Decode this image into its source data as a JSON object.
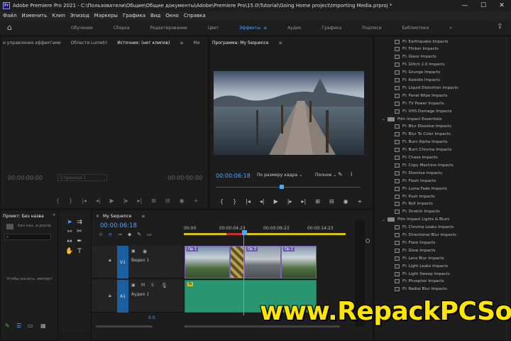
{
  "titlebar": {
    "title": "Adobe Premiere Pro 2021 - C:\\Пользователи\\Общие\\Общие документы\\Adobe\\Premiere Pro\\15.0\\Tutorial\\Going Home project\\Importing Media.prproj *",
    "minimize": "—",
    "maximize": "☐",
    "close": "✕"
  },
  "menu": [
    "Файл",
    "Изменить",
    "Клип",
    "Эпизод",
    "Маркеры",
    "Графика",
    "Вид",
    "Окно",
    "Справка"
  ],
  "workspaces": {
    "tabs": [
      "Обучение",
      "Сборка",
      "Редактирование",
      "Цвет",
      "Эффекты",
      "Аудио",
      "Графика",
      "Подписи",
      "Библиотеки"
    ],
    "active": "Эффекты",
    "more": "»"
  },
  "source_panel": {
    "tabs": [
      "и управления эффектами",
      "Области Lumetri",
      "Источник: (нет клипов)",
      "Ми"
    ],
    "active_tab": "Источник: (нет клипов)",
    "timecode_left": "00:00:00:00",
    "fit": "Страница 1",
    "timecode_right": "00:00:00:00"
  },
  "program_panel": {
    "title": "Программа: My Sequence",
    "timecode": "00:00:06:18",
    "fit": "По размеру кадра",
    "quality": "Полное"
  },
  "effects_panel": {
    "items": [
      {
        "type": "effect",
        "label": "FI: Earthquake Impacts"
      },
      {
        "type": "effect",
        "label": "FI: Flicker Impacts"
      },
      {
        "type": "effect",
        "label": "FI: Glass Impacts"
      },
      {
        "type": "effect",
        "label": "FI: Glitch 2.0 Impacts"
      },
      {
        "type": "effect",
        "label": "FI: Grunge Impacts"
      },
      {
        "type": "effect",
        "label": "FI: Kaleido Impacts"
      },
      {
        "type": "effect",
        "label": "FI: Liquid Distortion Impacts"
      },
      {
        "type": "effect",
        "label": "FI: Panel Wipe Impacts"
      },
      {
        "type": "effect",
        "label": "FI: TV Power Impacts"
      },
      {
        "type": "effect",
        "label": "FI: VHS Damage Impacts"
      },
      {
        "type": "folder",
        "label": "Film Impact Essentials"
      },
      {
        "type": "effect",
        "label": "FI: Blur Dissolve Impacts"
      },
      {
        "type": "effect",
        "label": "FI: Blur To Color Impacts"
      },
      {
        "type": "effect",
        "label": "FI: Burn Alpha Impacts"
      },
      {
        "type": "effect",
        "label": "FI: Burn Chroma Impacts"
      },
      {
        "type": "effect",
        "label": "FI: Chaos Impacts"
      },
      {
        "type": "effect",
        "label": "FI: Copy Machine Impacts"
      },
      {
        "type": "effect",
        "label": "FI: Dissolve Impacts"
      },
      {
        "type": "effect",
        "label": "FI: Flash Impacts"
      },
      {
        "type": "effect",
        "label": "FI: Luma Fade Impacts"
      },
      {
        "type": "effect",
        "label": "FI: Push Impacts"
      },
      {
        "type": "effect",
        "label": "FI: Roll Impacts"
      },
      {
        "type": "effect",
        "label": "FI: Stretch Impacts"
      },
      {
        "type": "folder",
        "label": "Film Impact Lights & Blurs"
      },
      {
        "type": "effect",
        "label": "FI: Chroma Leaks Impacts"
      },
      {
        "type": "effect",
        "label": "FI: Directional Blur Impacts"
      },
      {
        "type": "effect",
        "label": "FI: Flare Impacts"
      },
      {
        "type": "effect",
        "label": "FI: Glow Impacts"
      },
      {
        "type": "effect",
        "label": "FI: Lens Blur Impacts"
      },
      {
        "type": "effect",
        "label": "FI: Light Leaks Impacts"
      },
      {
        "type": "effect",
        "label": "FI: Light Sweep Impacts"
      },
      {
        "type": "effect",
        "label": "FI: Phosphor Impacts"
      },
      {
        "type": "effect",
        "label": "FI: Radial Blur Impacts"
      }
    ]
  },
  "project_panel": {
    "title": "Проект: Без назва",
    "file": "Без наз..а.prproj",
    "hint": "Чтобы начать, импорт",
    "more": "»"
  },
  "timeline": {
    "title": "My Sequence",
    "timecode": "00:00:06:18",
    "ruler": [
      "00:00",
      "00:00:04:23",
      "00:00:09:23",
      "00:00:14:23"
    ],
    "tracks": {
      "video_tag": "V1",
      "video_name": "Видео 1",
      "audio_tag": "A1",
      "audio_name": "Аудио 1"
    },
    "clips": [
      "Op 1",
      "Op 3",
      "Op 2"
    ],
    "audio_label": "fx",
    "zoom_value": "0.0"
  },
  "watermark": "www.RepackPCSoft.com",
  "colors": {
    "accent": "#4ea6ff",
    "video_track": "#1b5fa1",
    "audio_clip": "#2a9571",
    "watermark": "#ffe600"
  }
}
